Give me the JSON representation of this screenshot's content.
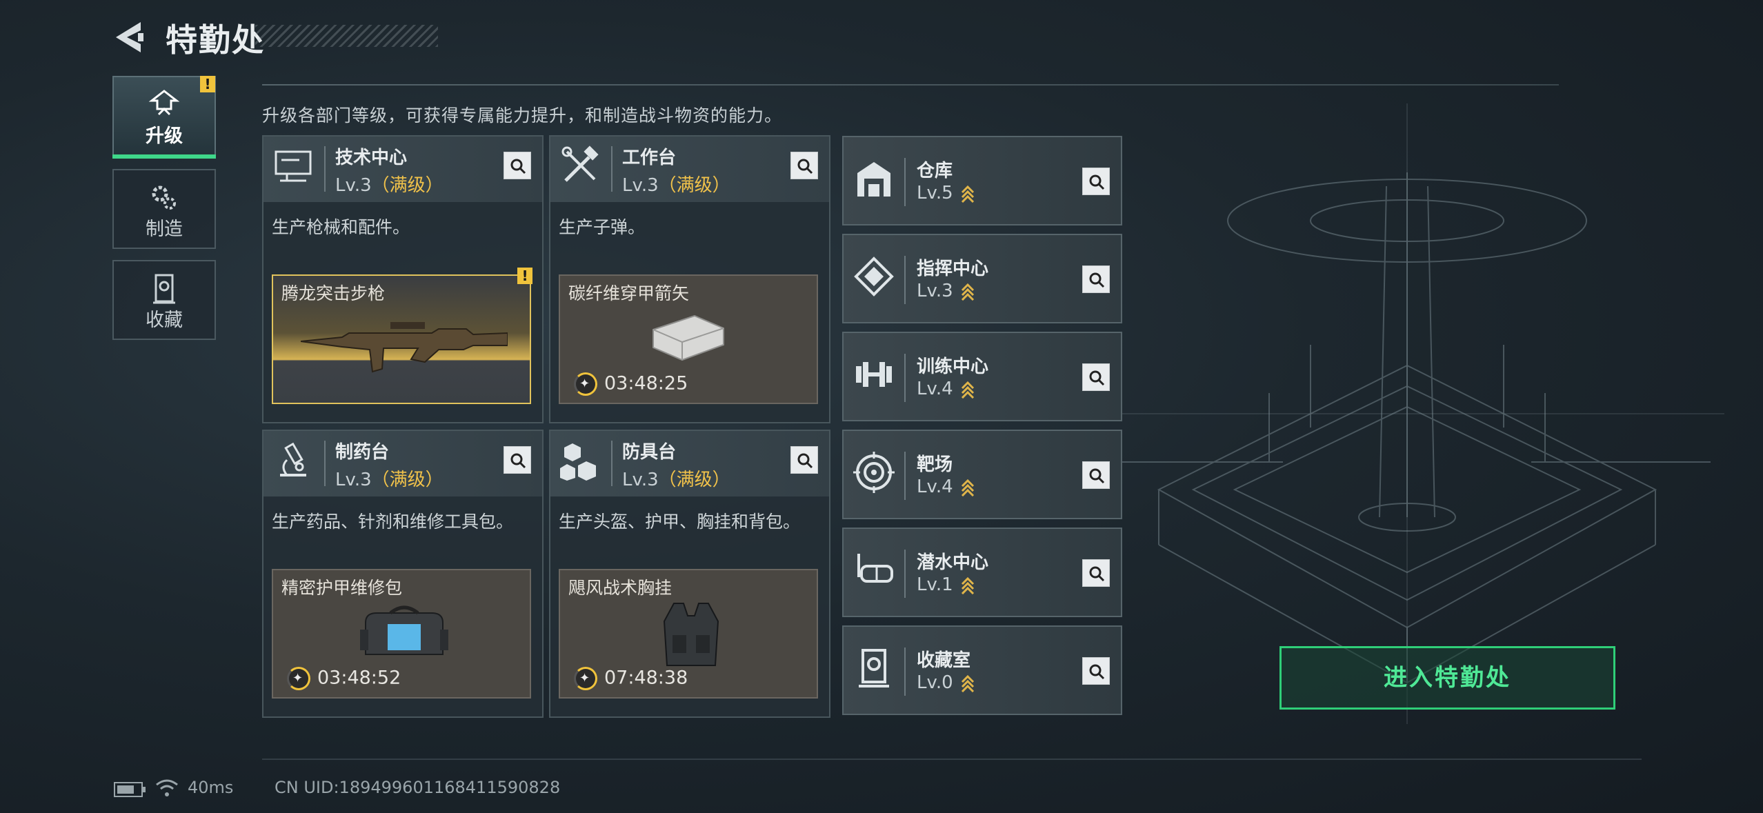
{
  "header": {
    "title": "特勤处"
  },
  "sidebar": {
    "items": [
      {
        "label": "升级",
        "icon": "upgrade-icon",
        "active": true
      },
      {
        "label": "制造",
        "icon": "gears-icon",
        "active": false
      },
      {
        "label": "收藏",
        "icon": "collection-icon",
        "active": false
      }
    ]
  },
  "description": "升级各部门等级，可获得专属能力提升，和制造战斗物资的能力。",
  "cards": [
    {
      "name": "技术中心",
      "level": "Lv.3",
      "status": "（满级）",
      "desc": "生产枪械和配件。",
      "item": "腾龙突击步枪",
      "timer": ""
    },
    {
      "name": "工作台",
      "level": "Lv.3",
      "status": "（满级）",
      "desc": "生产子弹。",
      "item": "碳纤维穿甲箭矢",
      "timer": "03:48:25"
    },
    {
      "name": "制药台",
      "level": "Lv.3",
      "status": "（满级）",
      "desc": "生产药品、针剂和维修工具包。",
      "item": "精密护甲维修包",
      "timer": "03:48:52"
    },
    {
      "name": "防具台",
      "level": "Lv.3",
      "status": "（满级）",
      "desc": "生产头盔、护甲、胸挂和背包。",
      "item": "飓风战术胸挂",
      "timer": "07:48:38"
    }
  ],
  "facilities": [
    {
      "name": "仓库",
      "level": "Lv.5"
    },
    {
      "name": "指挥中心",
      "level": "Lv.3"
    },
    {
      "name": "训练中心",
      "level": "Lv.4"
    },
    {
      "name": "靶场",
      "level": "Lv.4"
    },
    {
      "name": "潜水中心",
      "level": "Lv.1"
    },
    {
      "name": "收藏室",
      "level": "Lv.0"
    }
  ],
  "enter_button": "进入特勤处",
  "status_bar": {
    "ping": "40ms",
    "uid": "CN UID:18949960116841159082​8"
  },
  "colors": {
    "accent_green": "#3fd78a",
    "gold": "#f1c24a",
    "warning": "#f0c33c"
  }
}
